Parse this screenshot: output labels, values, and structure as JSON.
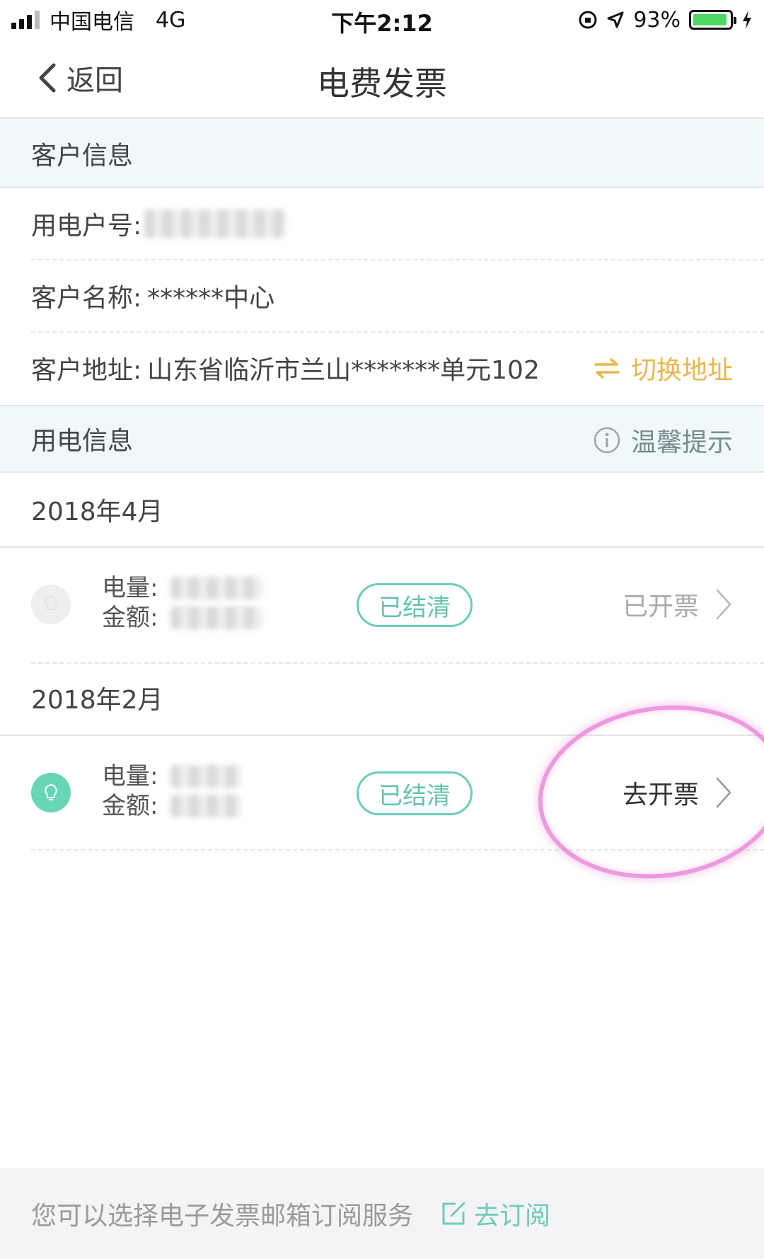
{
  "status_bar": {
    "carrier": "中国电信",
    "network": "4G",
    "time": "下午2:12",
    "battery_percent": "93%",
    "battery_level": 0.93
  },
  "nav": {
    "back_label": "返回",
    "title": "电费发票"
  },
  "customer_section": {
    "header": "客户信息",
    "account_label": "用电户号:",
    "name_label": "客户名称:",
    "name_value": "******中心",
    "address_label": "客户地址:",
    "address_value": "山东省临沂市兰山*******单元102",
    "switch_address": "切换地址"
  },
  "usage_section": {
    "header": "用电信息",
    "tip_label": "温馨提示"
  },
  "bills": [
    {
      "month": "2018年4月",
      "usage_label": "电量:",
      "amount_label": "金额:",
      "status": "已结清",
      "action": "已开票"
    },
    {
      "month": "2018年2月",
      "usage_label": "电量:",
      "amount_label": "金额:",
      "status": "已结清",
      "action": "去开票"
    }
  ],
  "footer": {
    "message": "您可以选择电子发票邮箱订阅服务",
    "subscribe_label": "去订阅"
  },
  "colors": {
    "section_bg": "#eff9fb",
    "accent_green": "#6ccdb8",
    "switch_yellow": "#e8b74d",
    "highlight_pink": "#e678d2"
  }
}
